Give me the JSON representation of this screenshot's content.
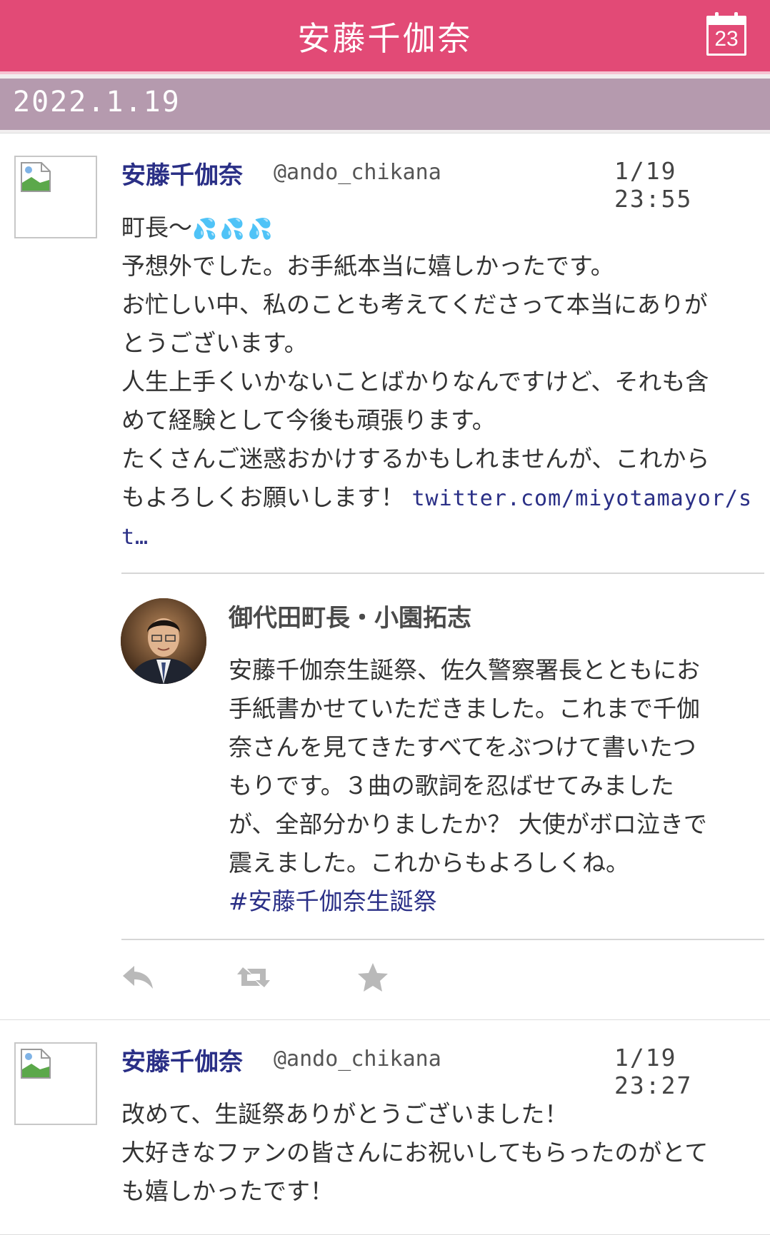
{
  "header": {
    "title": "安藤千伽奈",
    "calendar_day": "23"
  },
  "date": "2022.1.19",
  "tweets": [
    {
      "username": "安藤千伽奈",
      "handle": "@ando_chikana",
      "time": "1/19 23:55",
      "lines": [
        "町長〜",
        "予想外でした。お手紙本当に嬉しかったです。",
        "お忙しい中、私のことも考えてくださって本当にありが",
        "とうございます。",
        "人生上手くいかないことばかりなんですけど、それも含",
        "めて経験として今後も頑張ります。",
        "たくさんご迷惑おかけするかもしれませんが、これから",
        "もよろしくお願いします！"
      ],
      "drops": "💦💦💦",
      "link_part1": "twitter.com/miyotamayor/s",
      "link_part2": "t…",
      "quote": {
        "name": "御代田町長・小園拓志",
        "lines": [
          "安藤千伽奈生誕祭、佐久警察署長とともにお",
          "手紙書かせていただきました。これまで千伽",
          "奈さんを見てきたすべてをぶつけて書いたつ",
          "もりです。３曲の歌詞を忍ばせてみました",
          "が、全部分かりましたか？ 大使がボロ泣きで",
          "震えました。これからもよろしくね。"
        ],
        "hashtag": "#安藤千伽奈生誕祭"
      },
      "actions": [
        "reply-icon",
        "retweet-icon",
        "favorite-icon"
      ]
    },
    {
      "username": "安藤千伽奈",
      "handle": "@ando_chikana",
      "time": "1/19 23:27",
      "lines": [
        "改めて、生誕祭ありがとうございました！",
        "大好きなファンの皆さんにお祝いしてもらったのがとて",
        "も嬉しかったです！"
      ]
    }
  ],
  "colors": {
    "header": "#e24a76",
    "datebar": "#b59aae",
    "accent": "#2a2f86"
  }
}
